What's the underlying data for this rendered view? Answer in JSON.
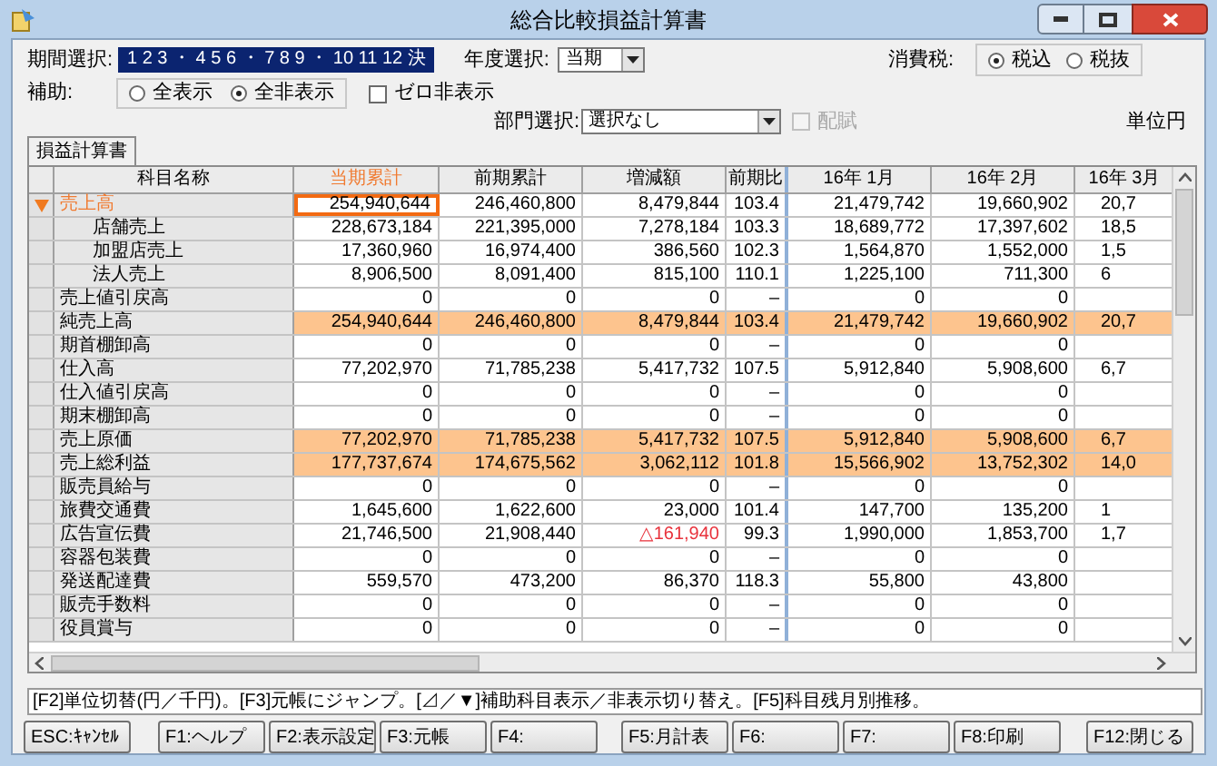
{
  "window": {
    "title": "総合比較損益計算書"
  },
  "period": {
    "label": "期間選択:",
    "value": "1 2 3 ・ 4 5 6 ・ 7 8 9 ・ 10 11 12 決"
  },
  "year": {
    "label": "年度選択:",
    "value": "当期"
  },
  "tax": {
    "label": "消費税:",
    "options": [
      {
        "label": "税込",
        "selected": true
      },
      {
        "label": "税抜",
        "selected": false
      }
    ]
  },
  "aux": {
    "label": "補助:",
    "options": [
      {
        "label": "全表示",
        "selected": false
      },
      {
        "label": "全非表示",
        "selected": true
      }
    ],
    "zero_hide": {
      "label": "ゼロ非表示",
      "checked": false
    }
  },
  "dept": {
    "label": "部門選択:",
    "value": "選択なし",
    "allocation": {
      "label": "配賦",
      "checked": false,
      "disabled": true
    }
  },
  "unit": "単位円",
  "tabs": [
    {
      "label": "損益計算書",
      "selected": true
    }
  ],
  "table": {
    "columns": [
      {
        "label": "科目名称",
        "selected": false
      },
      {
        "label": "当期累計",
        "selected": true
      },
      {
        "label": "前期累計",
        "selected": false
      },
      {
        "label": "増減額",
        "selected": false
      },
      {
        "label": "前期比",
        "selected": false
      },
      {
        "label": "16年 1月",
        "selected": false
      },
      {
        "label": "16年 2月",
        "selected": false
      },
      {
        "label": "16年 3月",
        "selected": false
      }
    ],
    "rows": [
      {
        "name": "売上高",
        "values": [
          "254,940,644",
          "246,460,800",
          "8,479,844",
          "103.4",
          "21,479,742",
          "19,660,902",
          "20,7"
        ],
        "highlight": false,
        "negative": false,
        "selected": true,
        "expanded": true,
        "children": [
          {
            "name": "店舗売上",
            "values": [
              "228,673,184",
              "221,395,000",
              "7,278,184",
              "103.3",
              "18,689,772",
              "17,397,602",
              "18,5"
            ],
            "highlight": false,
            "negative": false,
            "selected": false
          },
          {
            "name": "加盟店売上",
            "values": [
              "17,360,960",
              "16,974,400",
              "386,560",
              "102.3",
              "1,564,870",
              "1,552,000",
              "1,5"
            ],
            "highlight": false,
            "negative": false,
            "selected": false
          },
          {
            "name": "法人売上",
            "values": [
              "8,906,500",
              "8,091,400",
              "815,100",
              "110.1",
              "1,225,100",
              "711,300",
              "6"
            ],
            "highlight": false,
            "negative": false,
            "selected": false
          }
        ]
      },
      {
        "name": "売上値引戻高",
        "values": [
          "0",
          "0",
          "0",
          "–",
          "0",
          "0"
        ],
        "highlight": false,
        "negative": false,
        "selected": false
      },
      {
        "name": "純売上高",
        "values": [
          "254,940,644",
          "246,460,800",
          "8,479,844",
          "103.4",
          "21,479,742",
          "19,660,902",
          "20,7"
        ],
        "highlight": true,
        "negative": false,
        "selected": false
      },
      {
        "name": "期首棚卸高",
        "values": [
          "0",
          "0",
          "0",
          "–",
          "0",
          "0"
        ],
        "highlight": false,
        "negative": false,
        "selected": false
      },
      {
        "name": "仕入高",
        "values": [
          "77,202,970",
          "71,785,238",
          "5,417,732",
          "107.5",
          "5,912,840",
          "5,908,600",
          "6,7"
        ],
        "highlight": false,
        "negative": false,
        "selected": false
      },
      {
        "name": "仕入値引戻高",
        "values": [
          "0",
          "0",
          "0",
          "–",
          "0",
          "0"
        ],
        "highlight": false,
        "negative": false,
        "selected": false
      },
      {
        "name": "期末棚卸高",
        "values": [
          "0",
          "0",
          "0",
          "–",
          "0",
          "0"
        ],
        "highlight": false,
        "negative": false,
        "selected": false
      },
      {
        "name": "売上原価",
        "values": [
          "77,202,970",
          "71,785,238",
          "5,417,732",
          "107.5",
          "5,912,840",
          "5,908,600",
          "6,7"
        ],
        "highlight": true,
        "negative": false,
        "selected": false
      },
      {
        "name": "売上総利益",
        "values": [
          "177,737,674",
          "174,675,562",
          "3,062,112",
          "101.8",
          "15,566,902",
          "13,752,302",
          "14,0"
        ],
        "highlight": true,
        "negative": false,
        "selected": false
      },
      {
        "name": "販売員給与",
        "values": [
          "0",
          "0",
          "0",
          "–",
          "0",
          "0"
        ],
        "highlight": false,
        "negative": false,
        "selected": false
      },
      {
        "name": "旅費交通費",
        "values": [
          "1,645,600",
          "1,622,600",
          "23,000",
          "101.4",
          "147,700",
          "135,200",
          "1"
        ],
        "highlight": false,
        "negative": false,
        "selected": false
      },
      {
        "name": "広告宣伝費",
        "values": [
          "21,746,500",
          "21,908,440",
          "△161,940",
          "99.3",
          "1,990,000",
          "1,853,700",
          "1,7"
        ],
        "highlight": false,
        "negative": true,
        "selected": false
      },
      {
        "name": "容器包装費",
        "values": [
          "0",
          "0",
          "0",
          "–",
          "0",
          "0"
        ],
        "highlight": false,
        "negative": false,
        "selected": false
      },
      {
        "name": "発送配達費",
        "values": [
          "559,570",
          "473,200",
          "86,370",
          "118.3",
          "55,800",
          "43,800"
        ],
        "highlight": false,
        "negative": false,
        "selected": false
      },
      {
        "name": "販売手数料",
        "values": [
          "0",
          "0",
          "0",
          "–",
          "0",
          "0"
        ],
        "highlight": false,
        "negative": false,
        "selected": false
      },
      {
        "name": "役員賞与",
        "values": [
          "0",
          "0",
          "0",
          "–",
          "0",
          "0"
        ],
        "highlight": false,
        "negative": false,
        "selected": false
      }
    ]
  },
  "hint": "[F2]単位切替(円／千円)。[F3]元帳にジャンプ。[⊿／▼]補助科目表示／非表示切り替え。[F5]科目残月別推移。",
  "button_groups": [
    [
      "ESC:ｷｬﾝｾﾙ"
    ],
    [
      "F1:ヘルプ",
      "F2:表示設定",
      "F3:元帳",
      "F4:"
    ],
    [
      "F5:月計表",
      "F6:",
      "F7:",
      "F8:印刷"
    ],
    [
      "F12:閉じる"
    ]
  ]
}
